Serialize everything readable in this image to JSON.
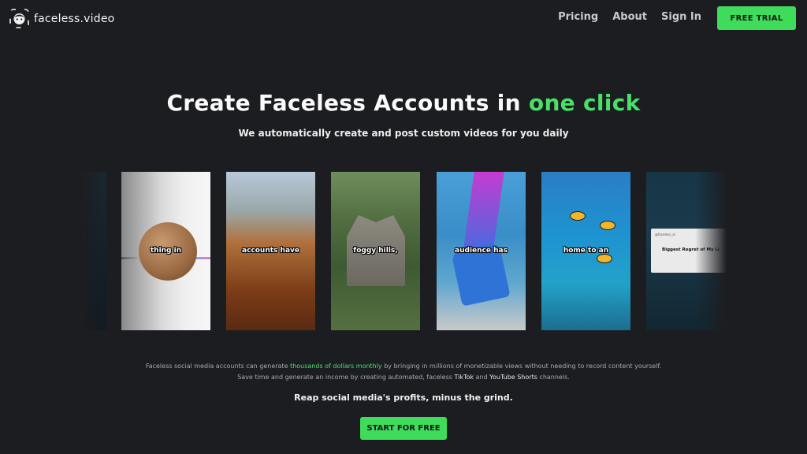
{
  "nav": {
    "logo_text": "faceless.video",
    "links": [
      "Pricing",
      "About",
      "Sign In"
    ],
    "trial_label": "FREE TRIAL"
  },
  "hero": {
    "title_main": "Create Faceless Accounts in ",
    "title_accent": "one click",
    "subtitle": "We automatically create and post custom videos for you daily"
  },
  "carousel": {
    "captions": [
      "thing in",
      "accounts have",
      "foggy hills,",
      "audience has",
      "home to an"
    ],
    "popup_head": "@faceless_ai",
    "popup_text": "Biggest Regret of My Li"
  },
  "description": {
    "part1": "Faceless social media accounts can generate ",
    "accent": "thousands of dollars monthly",
    "part2": " by bringing in millions of monetizable views without needing to record content yourself. Save time and generate an income by creating automated, faceless ",
    "tiktok": "TikTok",
    "and": " and ",
    "youtube": "YouTube Shorts",
    "part3": " channels."
  },
  "tagline": "Reap social media's profits, minus the grind.",
  "start_label": "START FOR FREE",
  "colors": {
    "background": "#1c1d21",
    "accent": "#47e068",
    "button": "#3fdc5c"
  }
}
